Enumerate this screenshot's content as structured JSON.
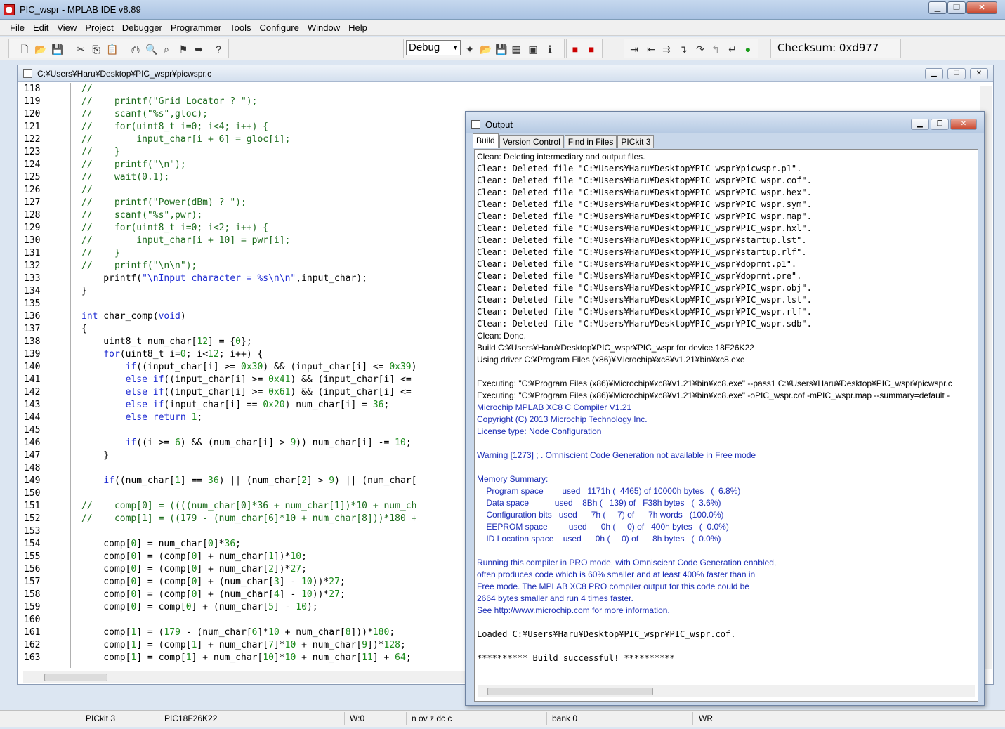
{
  "app": {
    "title": "PIC_wspr - MPLAB IDE v8.89"
  },
  "menu": [
    "File",
    "Edit",
    "View",
    "Project",
    "Debugger",
    "Programmer",
    "Tools",
    "Configure",
    "Window",
    "Help"
  ],
  "toolbar": {
    "configuration": "Debug",
    "checksum": "Checksum:  0xd977"
  },
  "editor": {
    "path": "C:¥Users¥Haru¥Desktop¥PIC_wspr¥picwspr.c",
    "lines": [
      {
        "n": "118",
        "code": "//"
      },
      {
        "n": "119",
        "code": "//    printf(\"Grid Locator ? \");"
      },
      {
        "n": "120",
        "code": "//    scanf(\"%s\",gloc);"
      },
      {
        "n": "121",
        "code": "//    for(uint8_t i=0; i<4; i++) {"
      },
      {
        "n": "122",
        "code": "//        input_char[i + 6] = gloc[i];"
      },
      {
        "n": "123",
        "code": "//    }"
      },
      {
        "n": "124",
        "code": "//    printf(\"\\n\");"
      },
      {
        "n": "125",
        "code": "//    wait(0.1);"
      },
      {
        "n": "126",
        "code": "//"
      },
      {
        "n": "127",
        "code": "//    printf(\"Power(dBm) ? \");"
      },
      {
        "n": "128",
        "code": "//    scanf(\"%s\",pwr);"
      },
      {
        "n": "129",
        "code": "//    for(uint8_t i=0; i<2; i++) {"
      },
      {
        "n": "130",
        "code": "//        input_char[i + 10] = pwr[i];"
      },
      {
        "n": "131",
        "code": "//    }"
      },
      {
        "n": "132",
        "code": "//    printf(\"\\n\\n\");"
      },
      {
        "n": "133",
        "code": "    printf(\"\\nInput character = %s\\n\\n\",input_char);"
      },
      {
        "n": "134",
        "code": "}"
      },
      {
        "n": "135",
        "code": ""
      },
      {
        "n": "136",
        "code": "int char_comp(void)"
      },
      {
        "n": "137",
        "code": "{"
      },
      {
        "n": "138",
        "code": "    uint8_t num_char[12] = {0};"
      },
      {
        "n": "139",
        "code": "    for(uint8_t i=0; i<12; i++) {"
      },
      {
        "n": "140",
        "code": "        if((input_char[i] >= 0x30) && (input_char[i] <= 0x39)"
      },
      {
        "n": "141",
        "code": "        else if((input_char[i] >= 0x41) && (input_char[i] <="
      },
      {
        "n": "142",
        "code": "        else if((input_char[i] >= 0x61) && (input_char[i] <="
      },
      {
        "n": "143",
        "code": "        else if(input_char[i] == 0x20) num_char[i] = 36;"
      },
      {
        "n": "144",
        "code": "        else return 1;"
      },
      {
        "n": "145",
        "code": ""
      },
      {
        "n": "146",
        "code": "        if((i >= 6) && (num_char[i] > 9)) num_char[i] -= 10;"
      },
      {
        "n": "147",
        "code": "    }"
      },
      {
        "n": "148",
        "code": ""
      },
      {
        "n": "149",
        "code": "    if((num_char[1] == 36) || (num_char[2] > 9) || (num_char["
      },
      {
        "n": "150",
        "code": ""
      },
      {
        "n": "151",
        "code": "//    comp[0] = ((((num_char[0]*36 + num_char[1])*10 + num_ch"
      },
      {
        "n": "152",
        "code": "//    comp[1] = ((179 - (num_char[6]*10 + num_char[8]))*180 +"
      },
      {
        "n": "153",
        "code": ""
      },
      {
        "n": "154",
        "code": "    comp[0] = num_char[0]*36;"
      },
      {
        "n": "155",
        "code": "    comp[0] = (comp[0] + num_char[1])*10;"
      },
      {
        "n": "156",
        "code": "    comp[0] = (comp[0] + num_char[2])*27;"
      },
      {
        "n": "157",
        "code": "    comp[0] = (comp[0] + (num_char[3] - 10))*27;"
      },
      {
        "n": "158",
        "code": "    comp[0] = (comp[0] + (num_char[4] - 10))*27;"
      },
      {
        "n": "159",
        "code": "    comp[0] = comp[0] + (num_char[5] - 10);"
      },
      {
        "n": "160",
        "code": ""
      },
      {
        "n": "161",
        "code": "    comp[1] = (179 - (num_char[6]*10 + num_char[8]))*180;"
      },
      {
        "n": "162",
        "code": "    comp[1] = (comp[1] + num_char[7]*10 + num_char[9])*128;"
      },
      {
        "n": "163",
        "code": "    comp[1] = comp[1] + num_char[10]*10 + num_char[11] + 64;"
      }
    ]
  },
  "output": {
    "title": "Output",
    "tabs": [
      "Build",
      "Version Control",
      "Find in Files",
      "PICkit 3"
    ],
    "lines": [
      {
        "t": "Clean: Deleting intermediary and output files.",
        "s": "n"
      },
      {
        "t": "Clean: Deleted file \"C:¥Users¥Haru¥Desktop¥PIC_wspr¥picwspr.p1\".",
        "s": "m"
      },
      {
        "t": "Clean: Deleted file \"C:¥Users¥Haru¥Desktop¥PIC_wspr¥PIC_wspr.cof\".",
        "s": "m"
      },
      {
        "t": "Clean: Deleted file \"C:¥Users¥Haru¥Desktop¥PIC_wspr¥PIC_wspr.hex\".",
        "s": "m"
      },
      {
        "t": "Clean: Deleted file \"C:¥Users¥Haru¥Desktop¥PIC_wspr¥PIC_wspr.sym\".",
        "s": "m"
      },
      {
        "t": "Clean: Deleted file \"C:¥Users¥Haru¥Desktop¥PIC_wspr¥PIC_wspr.map\".",
        "s": "m"
      },
      {
        "t": "Clean: Deleted file \"C:¥Users¥Haru¥Desktop¥PIC_wspr¥PIC_wspr.hxl\".",
        "s": "m"
      },
      {
        "t": "Clean: Deleted file \"C:¥Users¥Haru¥Desktop¥PIC_wspr¥startup.lst\".",
        "s": "m"
      },
      {
        "t": "Clean: Deleted file \"C:¥Users¥Haru¥Desktop¥PIC_wspr¥startup.rlf\".",
        "s": "m"
      },
      {
        "t": "Clean: Deleted file \"C:¥Users¥Haru¥Desktop¥PIC_wspr¥doprnt.p1\".",
        "s": "m"
      },
      {
        "t": "Clean: Deleted file \"C:¥Users¥Haru¥Desktop¥PIC_wspr¥doprnt.pre\".",
        "s": "m"
      },
      {
        "t": "Clean: Deleted file \"C:¥Users¥Haru¥Desktop¥PIC_wspr¥PIC_wspr.obj\".",
        "s": "m"
      },
      {
        "t": "Clean: Deleted file \"C:¥Users¥Haru¥Desktop¥PIC_wspr¥PIC_wspr.lst\".",
        "s": "m"
      },
      {
        "t": "Clean: Deleted file \"C:¥Users¥Haru¥Desktop¥PIC_wspr¥PIC_wspr.rlf\".",
        "s": "m"
      },
      {
        "t": "Clean: Deleted file \"C:¥Users¥Haru¥Desktop¥PIC_wspr¥PIC_wspr.sdb\".",
        "s": "m"
      },
      {
        "t": "Clean: Done.",
        "s": "n"
      },
      {
        "t": "Build C:¥Users¥Haru¥Desktop¥PIC_wspr¥PIC_wspr for device 18F26K22",
        "s": "n"
      },
      {
        "t": "Using driver C:¥Program Files (x86)¥Microchip¥xc8¥v1.21¥bin¥xc8.exe",
        "s": "n"
      },
      {
        "t": "",
        "s": "n"
      },
      {
        "t": "Executing: \"C:¥Program Files (x86)¥Microchip¥xc8¥v1.21¥bin¥xc8.exe\" --pass1 C:¥Users¥Haru¥Desktop¥PIC_wspr¥picwspr.c",
        "s": "n"
      },
      {
        "t": "Executing: \"C:¥Program Files (x86)¥Microchip¥xc8¥v1.21¥bin¥xc8.exe\" -oPIC_wspr.cof -mPIC_wspr.map --summary=default -",
        "s": "n"
      },
      {
        "t": "Microchip MPLAB XC8 C Compiler V1.21",
        "s": "b"
      },
      {
        "t": "Copyright (C) 2013 Microchip Technology Inc.",
        "s": "b"
      },
      {
        "t": "License type: Node Configuration",
        "s": "b"
      },
      {
        "t": "",
        "s": "b"
      },
      {
        "t": "Warning [1273] ; . Omniscient Code Generation not available in Free mode",
        "s": "b"
      },
      {
        "t": "",
        "s": "b"
      },
      {
        "t": "Memory Summary:",
        "s": "b"
      },
      {
        "t": "    Program space        used   1171h (  4465) of 10000h bytes   (  6.8%)",
        "s": "b"
      },
      {
        "t": "    Data space           used    8Bh (   139) of   F38h bytes   (  3.6%)",
        "s": "b"
      },
      {
        "t": "    Configuration bits   used      7h (     7) of      7h words   (100.0%)",
        "s": "b"
      },
      {
        "t": "    EEPROM space         used      0h (     0) of   400h bytes   (  0.0%)",
        "s": "b"
      },
      {
        "t": "    ID Location space    used      0h (     0) of      8h bytes   (  0.0%)",
        "s": "b"
      },
      {
        "t": "",
        "s": "b"
      },
      {
        "t": "Running this compiler in PRO mode, with Omniscient Code Generation enabled,",
        "s": "b"
      },
      {
        "t": "often produces code which is 60% smaller and at least 400% faster than in",
        "s": "b"
      },
      {
        "t": "Free mode. The MPLAB XC8 PRO compiler output for this code could be",
        "s": "b"
      },
      {
        "t": "2664 bytes smaller and run 4 times faster.",
        "s": "b"
      },
      {
        "t": "See http://www.microchip.com for more information.",
        "s": "b"
      },
      {
        "t": "",
        "s": "n"
      },
      {
        "t": "Loaded C:¥Users¥Haru¥Desktop¥PIC_wspr¥PIC_wspr.cof.",
        "s": "m"
      },
      {
        "t": "",
        "s": "n"
      },
      {
        "t": "********** Build successful! **********",
        "s": "m"
      }
    ]
  },
  "status": {
    "tool": "PICkit 3",
    "device": "PIC18F26K22",
    "wreg": "W:0",
    "flags": "n ov z dc c",
    "bank": "bank 0",
    "mode": "WR"
  }
}
